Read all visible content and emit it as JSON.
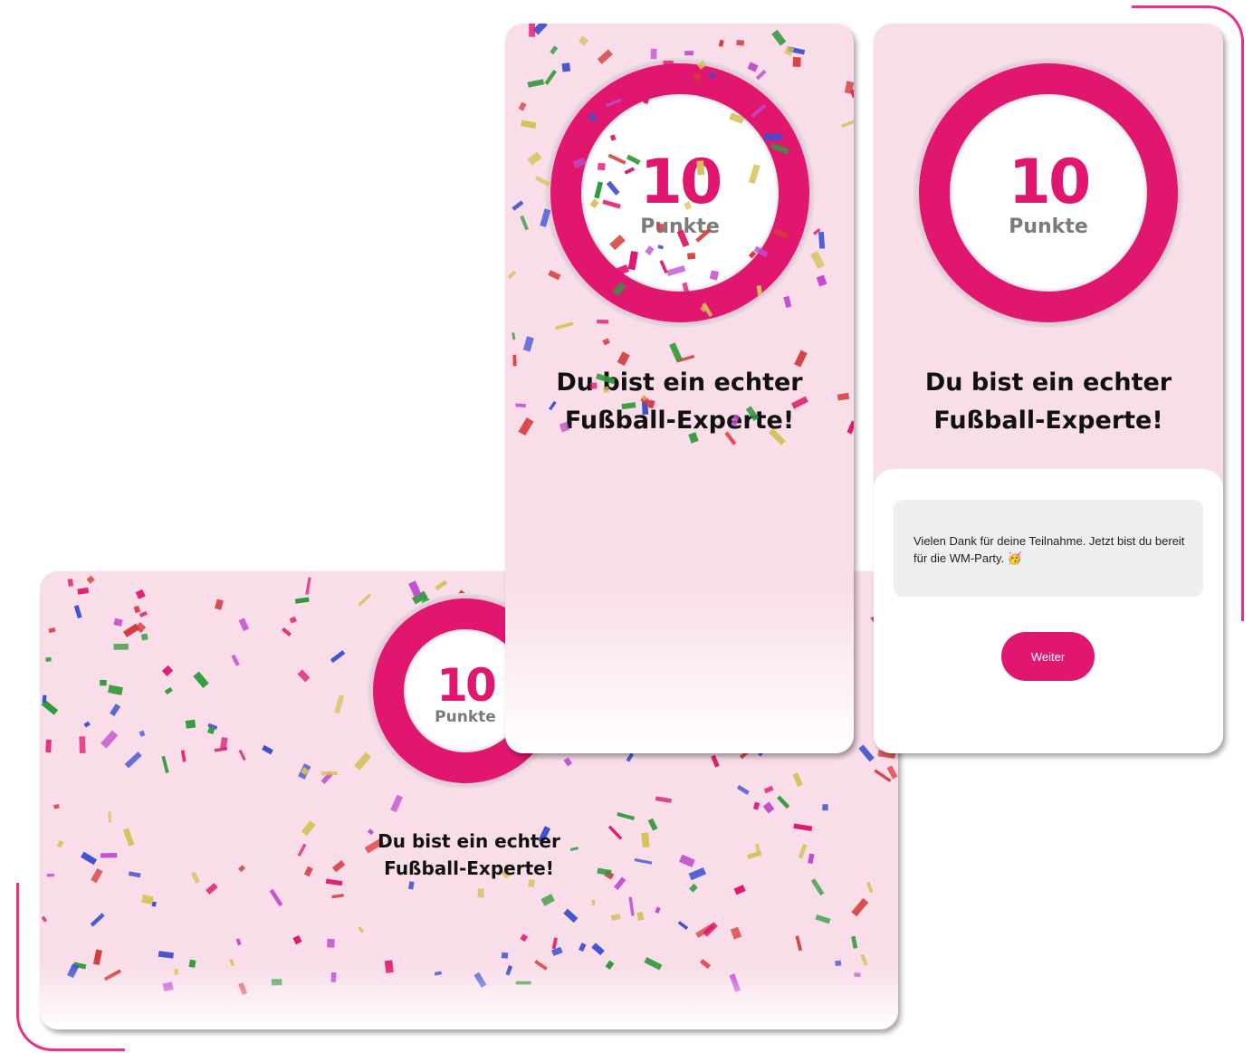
{
  "colors": {
    "accent": "#e0166f",
    "card_background": "#f9dde9",
    "label_gray": "#7b7b7b",
    "message_background": "#efefef",
    "confetti": [
      "#e0166f",
      "#3b4fd0",
      "#2f9a3a",
      "#d4c25a",
      "#d63a3a",
      "#c24bd0"
    ]
  },
  "result_wide": {
    "score": "10",
    "score_label": "Punkte",
    "headline_line1": "Du bist ein echter",
    "headline_line2": "Fußball-Experte!"
  },
  "result_mid": {
    "score": "10",
    "score_label": "Punkte",
    "headline_line1": "Du bist ein echter",
    "headline_line2": "Fußball-Experte!"
  },
  "result_final": {
    "score": "10",
    "score_label": "Punkte",
    "headline_line1": "Du bist ein echter",
    "headline_line2": "Fußball-Experte!",
    "message": "Vielen Dank für deine Teilnahme. Jetzt bist du bereit für die WM-Party. 🥳",
    "continue_button": "Weiter"
  }
}
